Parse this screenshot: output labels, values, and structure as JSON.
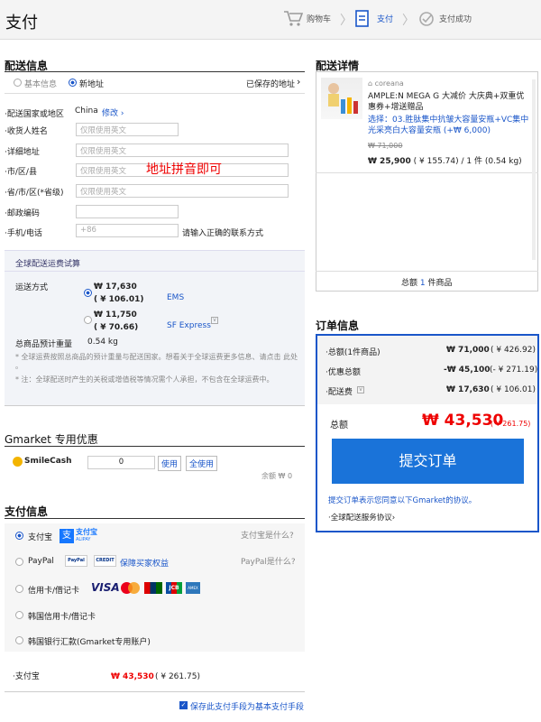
{
  "header": {
    "title": "支付",
    "steps": [
      "购物车",
      "支付",
      "支付成功"
    ]
  },
  "shipping": {
    "title": "配送信息",
    "basic_info": "基本信息",
    "new_address": "新地址",
    "saved_address": "已保存的地址",
    "country_label": "配送国家或地区",
    "country_value": "China",
    "modify": "修改",
    "name_label": "收货人姓名",
    "address_label": "详细地址",
    "city_label": "市/区/县",
    "province_label": "省/市/区(*省级)",
    "zip_label": "邮政编码",
    "phone_label": "手机/电话",
    "en_only_placeholder": "仅限使用英文",
    "phone_prefix": "+86",
    "phone_hint": "请输入正确的联系方式",
    "annotation": "地址拼音即可"
  },
  "calc": {
    "title": "全球配送运费试算",
    "method_label": "运送方式",
    "options": [
      {
        "price": "₩ 17,630",
        "cny": "( ¥ 106.01)",
        "name": "EMS"
      },
      {
        "price": "₩ 11,750",
        "cny": "( ¥ 70.66)",
        "name": "SF Express"
      }
    ],
    "weight_label": "总商品预计重量",
    "weight_value": "0.54 kg",
    "note1": "* 全球运费按照总商品的预计重量与配送国家。想看关于全球运费更多信息、请点击 此处 。",
    "note2": "* 注：全球配送时产生的关税或增值税等情况需个人承担，不包含在全球运费中。"
  },
  "coupon": {
    "title": "Gmarket 专用优惠",
    "smilecash": "SmileCash",
    "value": "0",
    "use": "使用",
    "use_all": "全使用",
    "remain": "余额 ₩ 0"
  },
  "payment": {
    "title": "支付信息",
    "methods": [
      {
        "label": "支付宝",
        "help": "支付宝是什么?"
      },
      {
        "label": "PayPal",
        "help": "PayPal是什么?"
      },
      {
        "label": "信用卡/借记卡",
        "help": ""
      },
      {
        "label": "韩国信用卡/借记卡",
        "help": ""
      },
      {
        "label": "韩国银行汇款(Gmarket专用账户)",
        "help": ""
      }
    ],
    "paypal_protect": "保障买家权益",
    "summary_label": "支付宝",
    "summary_amount": "₩ 43,530",
    "summary_cny": "( ¥ 261.75)",
    "save_default": "保存此支付手段为基本支付手段",
    "alipay_logo": "支付宝",
    "alipay_sub": "ALIPAY",
    "card_logos": [
      "VISA",
      "MC",
      "JCB",
      "AMEX"
    ]
  },
  "delivery": {
    "title": "配送详情",
    "brand": "coreana",
    "product": "AMPLE:N MEGA G 大减价 大庆典+双重优惠券+增送赠品",
    "option": "选择：03.胜肽集中抗皱大容量安瓶+VC集中光采亮白大容量安瓶 (+₩ 6,000)",
    "old_price": "₩ 71,000",
    "price": "₩ 25,900",
    "price_detail": "( ¥ 155.74) / 1 件 (0.54 kg)",
    "total_prefix": "总额 ",
    "total_count": "1",
    "total_suffix": " 件商品"
  },
  "order": {
    "title": "订单信息",
    "rows": [
      {
        "label": "总额(1件商品)",
        "amount": "₩ 71,000",
        "cny": "( ¥ 426.92)"
      },
      {
        "label": "优惠总额",
        "amount": "-₩ 45,100",
        "cny": "(- ¥ 271.19)"
      },
      {
        "label": "配送费",
        "amount": "₩ 17,630",
        "cny": "( ¥ 106.01)"
      }
    ],
    "total_label": "总额",
    "total_amount": "₩ 43,530",
    "total_cny": "( ¥ 261.75)",
    "submit": "提交订单",
    "agree": "提交订单表示您同意以下Gmarket的协议。",
    "terms": "全球配送服务协议"
  },
  "colors": {
    "accent": "#1a56c9",
    "button": "#1a73d9",
    "price_red": "#e00"
  }
}
